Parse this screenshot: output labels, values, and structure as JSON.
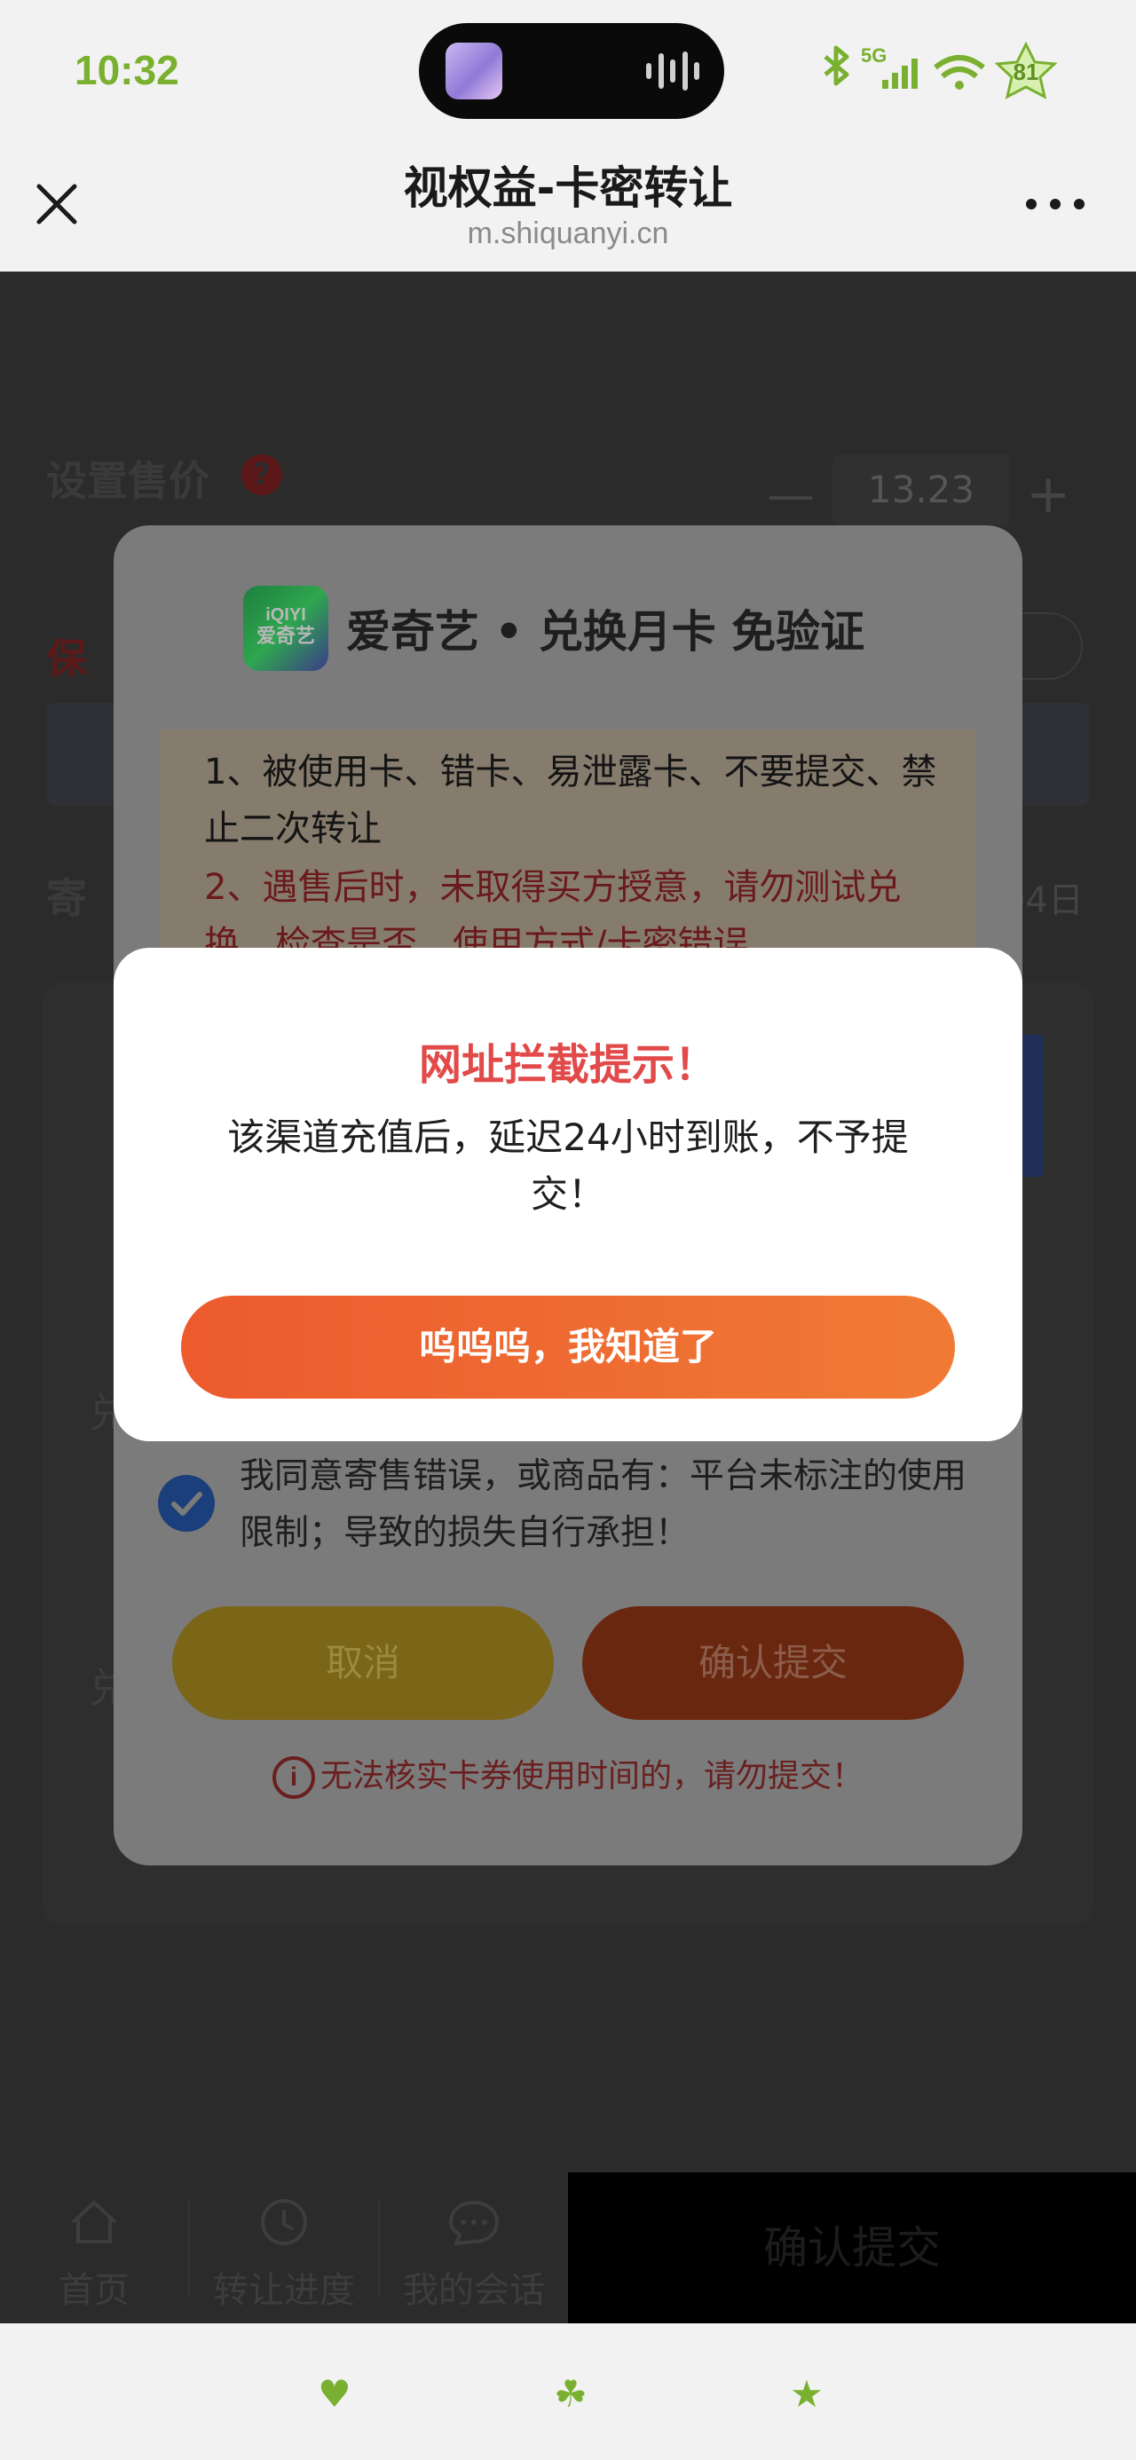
{
  "status_bar": {
    "time": "10:32",
    "network": "5G",
    "battery": "81",
    "accent_color": "#7ab030"
  },
  "browser": {
    "title": "视权益-卡密转让",
    "url": "m.shiquanyi.cn",
    "close_icon": "close-icon",
    "more_icon": "more-icon"
  },
  "background_form": {
    "set_price_label": "设置售价",
    "price_value": "13.23",
    "stepper_minus": "—",
    "stepper_plus": "+",
    "guarantee_label": "保",
    "consign_label": "寄",
    "consign_date_suffix": "04日",
    "redeem_label_1": "兑",
    "redeem_label_2": "兑"
  },
  "product_sheet": {
    "logo_text": "iQIYI",
    "logo_sub": "爱奇艺",
    "title": "爱奇艺 • 兑换月卡 免验证",
    "notice_1": "1、被使用卡、错卡、易泄露卡、不要提交、禁止二次转让",
    "notice_2": "2、遇售后时，未取得买方授意，请勿测试兑换，检查是否，使用方式/卡密错误",
    "agree_text": "我同意寄售错误，或商品有：平台未标注的使用限制；导致的损失自行承担！",
    "agree_checked": true,
    "cancel_button": "取消",
    "confirm_button": "确认提交",
    "warning_text": "无法核实卡券使用时间的，请勿提交！",
    "warning_icon": "i"
  },
  "alert": {
    "title": "网址拦截提示！",
    "message": "该渠道充值后，延迟24小时到账，不予提交！",
    "button": "呜呜呜，我知道了",
    "title_color": "#e24a4a",
    "button_gradient": [
      "#ec5a2e",
      "#f07b35"
    ]
  },
  "bottom_nav": {
    "items": [
      {
        "label": "首页",
        "icon": "home-icon"
      },
      {
        "label": "转让进度",
        "icon": "clock-icon"
      },
      {
        "label": "我的会话",
        "icon": "chat-icon"
      }
    ],
    "submit": "确认提交"
  },
  "system_bar": {
    "icons": [
      "heart-icon",
      "clover-icon",
      "star-icon"
    ]
  }
}
